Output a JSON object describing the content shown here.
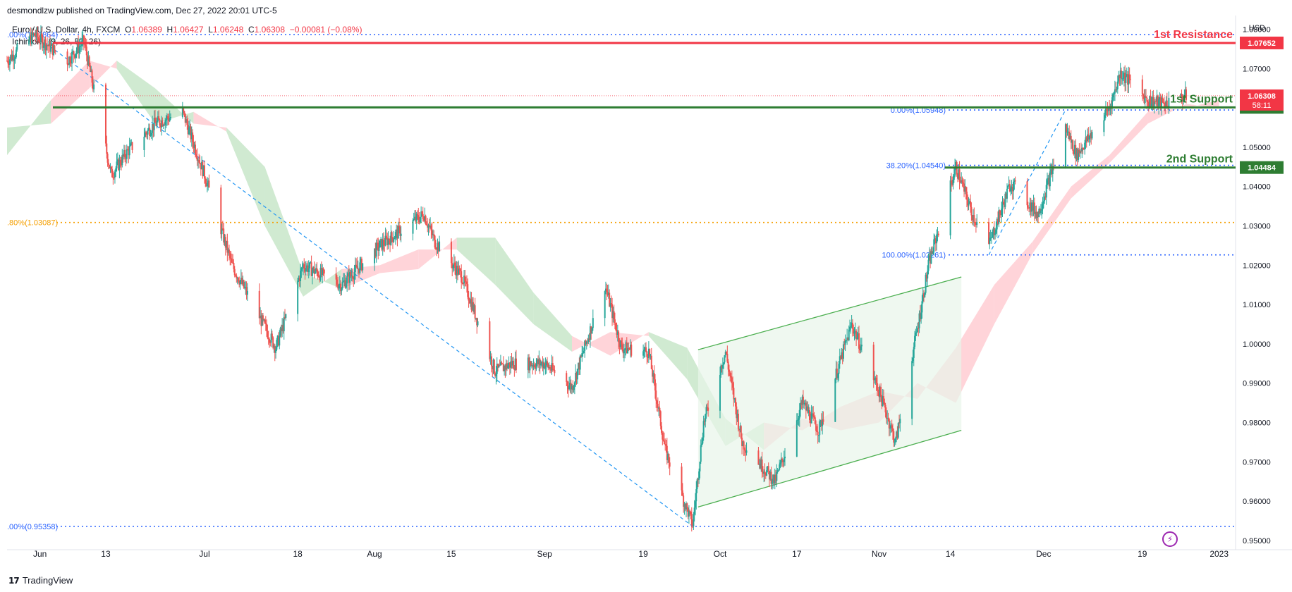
{
  "header": {
    "published": "desmondlzw published on TradingView.com, Dec 27, 2022 20:01 UTC-5",
    "symbol": "Euro / U.S. Dollar, 4h, FXCM",
    "o_label": "O",
    "o_value": "1.06389",
    "h_label": "H",
    "h_value": "1.06427",
    "l_label": "L",
    "l_value": "1.06248",
    "c_label": "C",
    "c_value": "1.06308",
    "change": "−0.00081 (−0.08%)",
    "indicator": "Ichimoku (9, 26, 52, 26)",
    "currency": "USD"
  },
  "footer": {
    "brand": "TradingView",
    "brand_logo": "17"
  },
  "colors": {
    "up": "#26a69a",
    "down": "#ef5350",
    "resistance": "#f23645",
    "support": "#2e7d32",
    "fib": "#2962ff",
    "fib_mid": "#f59f00",
    "channel": "#4caf50",
    "cloud_bull": "#c8e6c9",
    "cloud_bear": "#ffcdd2"
  },
  "chart_data": {
    "type": "candlestick",
    "title": "Euro / U.S. Dollar, 4h, FXCM",
    "ylim": [
      0.948,
      1.0835
    ],
    "yticks": [
      "1.08000",
      "1.07000",
      "1.06000",
      "1.05000",
      "1.04000",
      "1.03000",
      "1.02000",
      "1.01000",
      "1.00000",
      "0.99000",
      "0.98000",
      "0.97000",
      "0.96000",
      "0.95000"
    ],
    "xticks": [
      "Jun",
      "13",
      "Jul",
      "18",
      "Aug",
      "15",
      "Sep",
      "19",
      "Oct",
      "17",
      "Nov",
      "14",
      "Dec",
      "19",
      "2023"
    ],
    "x_start": "2022-05-26",
    "x_end": "2023-01-05",
    "key_levels": [
      {
        "label": "1st Resistance",
        "value": 1.07652,
        "price_tag": "1.07652",
        "kind": "resistance"
      },
      {
        "label": "1st Support",
        "value": 1.06014,
        "price_tag": "1.06014",
        "kind": "support"
      },
      {
        "label": "2nd Support",
        "value": 1.04484,
        "price_tag": "1.04484",
        "kind": "support"
      }
    ],
    "current_price": {
      "value": 1.06308,
      "price_tag": "1.06308",
      "countdown": "58:11"
    },
    "fib_levels": [
      {
        "text": ".00%(1.07864)",
        "value": 1.07864,
        "set": "left"
      },
      {
        "text": ".80%(1.03087)",
        "value": 1.03087,
        "set": "left"
      },
      {
        "text": ".00%(0.95358)",
        "value": 0.95358,
        "set": "left"
      },
      {
        "text": "0.00%(1.05948)",
        "value": 1.05948,
        "set": "right"
      },
      {
        "text": "38.20%(1.04540)",
        "value": 1.0454,
        "set": "right"
      },
      {
        "text": "100.00%(1.02261)",
        "value": 1.02261,
        "set": "right"
      }
    ],
    "path": [
      [
        "2022-05-26",
        1.072
      ],
      [
        "2022-05-31",
        1.0786
      ],
      [
        "2022-06-06",
        1.072
      ],
      [
        "2022-06-09",
        1.077
      ],
      [
        "2022-06-14",
        1.043
      ],
      [
        "2022-06-17",
        1.049
      ],
      [
        "2022-06-22",
        1.056
      ],
      [
        "2022-06-27",
        1.059
      ],
      [
        "2022-07-01",
        1.043
      ],
      [
        "2022-07-06",
        1.02
      ],
      [
        "2022-07-14",
        0.999
      ],
      [
        "2022-07-19",
        1.02
      ],
      [
        "2022-07-26",
        1.015
      ],
      [
        "2022-08-02",
        1.025
      ],
      [
        "2022-08-10",
        1.033
      ],
      [
        "2022-08-12",
        1.026
      ],
      [
        "2022-08-17",
        1.017
      ],
      [
        "2022-08-23",
        0.993
      ],
      [
        "2022-08-26",
        0.995
      ],
      [
        "2022-09-01",
        0.995
      ],
      [
        "2022-09-06",
        0.989
      ],
      [
        "2022-09-12",
        1.015
      ],
      [
        "2022-09-15",
        0.999
      ],
      [
        "2022-09-20",
        0.998
      ],
      [
        "2022-09-23",
        0.973
      ],
      [
        "2022-09-28",
        0.954
      ],
      [
        "2022-09-30",
        0.98
      ],
      [
        "2022-10-04",
        0.998
      ],
      [
        "2022-10-07",
        0.975
      ],
      [
        "2022-10-13",
        0.965
      ],
      [
        "2022-10-18",
        0.985
      ],
      [
        "2022-10-21",
        0.978
      ],
      [
        "2022-10-27",
        1.005
      ],
      [
        "2022-11-01",
        0.988
      ],
      [
        "2022-11-04",
        0.975
      ],
      [
        "2022-11-08",
        1.004
      ],
      [
        "2022-11-10",
        1.02
      ],
      [
        "2022-11-15",
        1.045
      ],
      [
        "2022-11-18",
        1.033
      ],
      [
        "2022-11-21",
        1.025
      ],
      [
        "2022-11-25",
        1.041
      ],
      [
        "2022-11-30",
        1.033
      ],
      [
        "2022-12-05",
        1.055
      ],
      [
        "2022-12-07",
        1.048
      ],
      [
        "2022-12-13",
        1.06
      ],
      [
        "2022-12-15",
        1.069
      ],
      [
        "2022-12-20",
        1.062
      ],
      [
        "2022-12-23",
        1.061
      ],
      [
        "2022-12-27",
        1.0631
      ]
    ],
    "channel": {
      "upper": [
        [
          "2022-09-29",
          0.9985
        ],
        [
          "2022-11-16",
          1.017
        ]
      ],
      "lower": [
        [
          "2022-09-29",
          0.9585
        ],
        [
          "2022-11-16",
          0.978
        ]
      ]
    },
    "trendline": [
      [
        "2022-05-31",
        1.0786
      ],
      [
        "2022-09-28",
        0.9536
      ]
    ],
    "trendline2": [
      [
        "2022-11-21",
        1.0226
      ],
      [
        "2022-12-05",
        1.0595
      ]
    ],
    "cloud": [
      [
        "2022-05-26",
        1.055,
        1.048
      ],
      [
        "2022-06-03",
        1.056,
        1.062
      ],
      [
        "2022-06-10",
        1.065,
        1.072
      ],
      [
        "2022-06-15",
        1.072,
        1.07
      ],
      [
        "2022-06-22",
        1.065,
        1.056
      ],
      [
        "2022-06-29",
        1.056,
        1.059
      ],
      [
        "2022-07-05",
        1.055,
        1.054
      ],
      [
        "2022-07-12",
        1.045,
        1.03
      ],
      [
        "2022-07-19",
        1.018,
        1.012
      ],
      [
        "2022-07-26",
        1.014,
        1.019
      ],
      [
        "2022-08-02",
        1.018,
        1.02
      ],
      [
        "2022-08-09",
        1.019,
        1.024
      ],
      [
        "2022-08-16",
        1.027,
        1.024
      ],
      [
        "2022-08-23",
        1.027,
        1.015
      ],
      [
        "2022-08-30",
        1.013,
        1.005
      ],
      [
        "2022-09-06",
        1.002,
        0.998
      ],
      [
        "2022-09-13",
        0.997,
        1.003
      ],
      [
        "2022-09-20",
        1.003,
        1.002
      ],
      [
        "2022-09-27",
        0.999,
        0.991
      ],
      [
        "2022-10-04",
        0.981,
        0.974
      ],
      [
        "2022-10-11",
        0.973,
        0.98
      ],
      [
        "2022-10-18",
        0.981,
        0.978
      ],
      [
        "2022-10-25",
        0.978,
        0.984
      ],
      [
        "2022-11-01",
        0.98,
        0.988
      ],
      [
        "2022-11-08",
        0.99,
        0.986
      ],
      [
        "2022-11-15",
        0.985,
        0.999
      ],
      [
        "2022-11-22",
        1.005,
        1.015
      ],
      [
        "2022-11-29",
        1.023,
        1.026
      ],
      [
        "2022-12-06",
        1.037,
        1.04
      ],
      [
        "2022-12-13",
        1.046,
        1.048
      ],
      [
        "2022-12-20",
        1.056,
        1.059
      ],
      [
        "2022-12-27",
        1.061,
        1.06
      ],
      [
        "2023-01-02",
        1.06,
        1.062
      ]
    ]
  }
}
